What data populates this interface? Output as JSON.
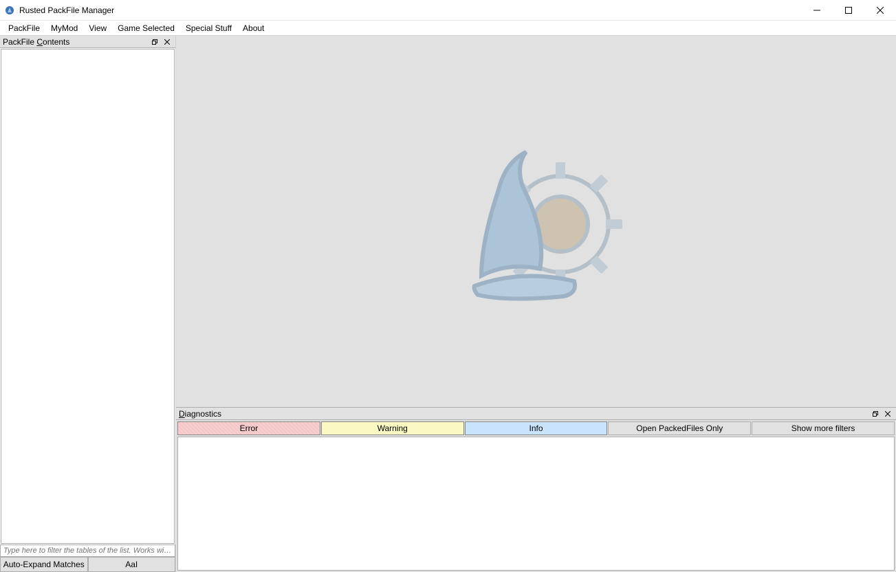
{
  "window": {
    "title": "Rusted PackFile Manager"
  },
  "menu": {
    "items": [
      "PackFile",
      "MyMod",
      "View",
      "Game Selected",
      "Special Stuff",
      "About"
    ]
  },
  "left_panel": {
    "title_prefix": "PackFile ",
    "title_mnemonic": "C",
    "title_suffix": "ontents",
    "filter_placeholder": "Type here to filter the tables of the list. Works wit...",
    "auto_expand_label": "Auto-Expand Matches",
    "case_label": "AaI"
  },
  "diagnostics": {
    "title_mnemonic": "D",
    "title_suffix": "iagnostics",
    "filters": {
      "error": "Error",
      "warning": "Warning",
      "info": "Info",
      "open_only": "Open PackedFiles Only",
      "show_more": "Show more filters"
    }
  }
}
